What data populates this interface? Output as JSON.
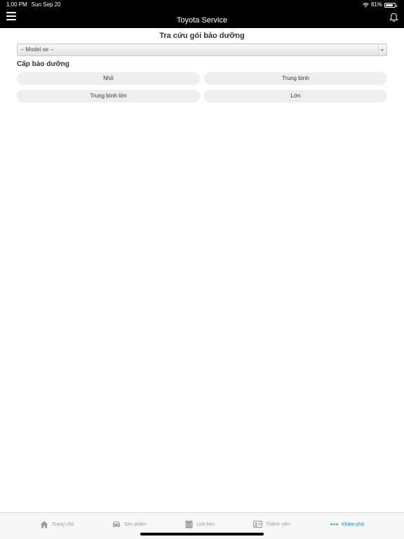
{
  "status_bar": {
    "time": "1:00 PM",
    "date": "Sun Sep 20",
    "battery": "81%",
    "battery_level": 0.81
  },
  "header": {
    "title": "Toyota Service"
  },
  "main": {
    "heading": "Tra cứu gói bảo dưỡng",
    "model_select": {
      "value": "-- Model xe --"
    },
    "section_label": "Cấp bảo dưỡng",
    "levels": [
      "Nhỏ",
      "Trung bình",
      "Trung bình lớn",
      "Lớn"
    ]
  },
  "tabs": [
    {
      "label": "Trang chủ",
      "icon": "home-icon",
      "active": false
    },
    {
      "label": "Sản phẩm",
      "icon": "car-icon",
      "active": false
    },
    {
      "label": "Lịch hẹn",
      "icon": "calendar-icon",
      "active": false
    },
    {
      "label": "Thành viên",
      "icon": "member-card-icon",
      "active": false
    },
    {
      "label": "Khám phá",
      "icon": "more-dots-icon",
      "active": true
    }
  ],
  "colors": {
    "active_tab": "#1a8fe0",
    "inactive_tab": "#999999",
    "header_bg": "#000000"
  }
}
